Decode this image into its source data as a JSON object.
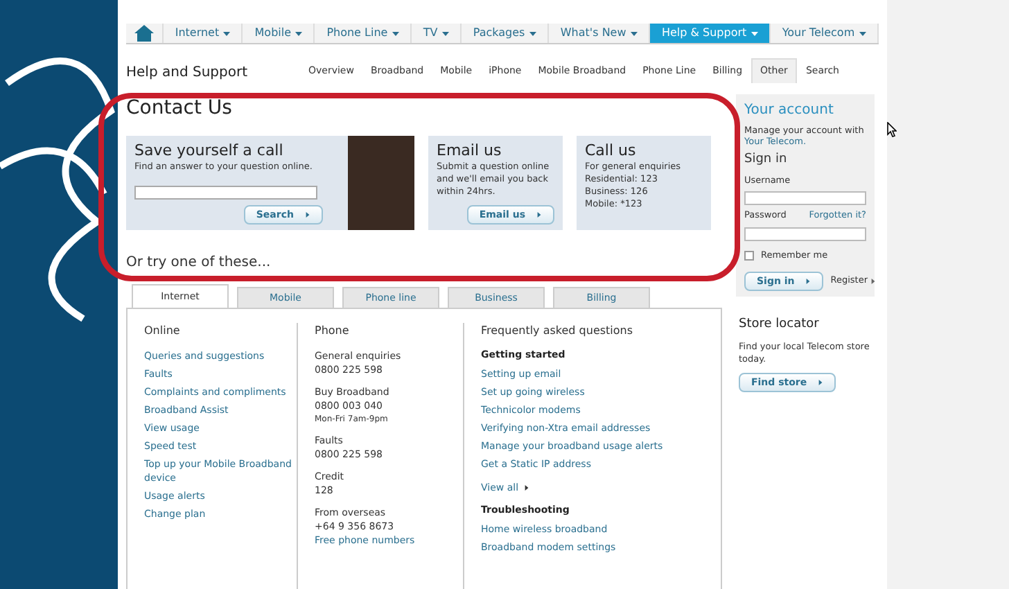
{
  "nav": [
    {
      "kind": "home"
    },
    {
      "kind": "menu",
      "label": "Internet",
      "selected": false
    },
    {
      "kind": "menu",
      "label": "Mobile",
      "selected": false
    },
    {
      "kind": "menu",
      "label": "Phone Line",
      "selected": false
    },
    {
      "kind": "menu",
      "label": "TV",
      "selected": false
    },
    {
      "kind": "menu",
      "label": "Packages",
      "selected": false
    },
    {
      "kind": "menu",
      "label": "What's New",
      "selected": false
    },
    {
      "kind": "menu",
      "label": "Help & Support",
      "selected": true
    },
    {
      "kind": "menu",
      "label": "Your Telecom",
      "selected": false
    }
  ],
  "page_title": "Help and Support",
  "subnav": [
    {
      "label": "Overview",
      "selected": false
    },
    {
      "label": "Broadband",
      "selected": false
    },
    {
      "label": "Mobile",
      "selected": false
    },
    {
      "label": "iPhone",
      "selected": false
    },
    {
      "label": "Mobile Broadband",
      "selected": false
    },
    {
      "label": "Phone Line",
      "selected": false
    },
    {
      "label": "Billing",
      "selected": false
    },
    {
      "label": "Other",
      "selected": true
    },
    {
      "label": "Search",
      "selected": false
    }
  ],
  "contact": {
    "title": "Contact Us",
    "cards": [
      {
        "kind": "search",
        "title": "Save yourself a call",
        "text": "Find an answer to your question online.",
        "button": "Search"
      },
      {
        "kind": "email",
        "title": "Email us",
        "text": "Submit a question online and we'll email you back within 24hrs.",
        "button": "Email us"
      },
      {
        "kind": "call",
        "title": "Call us",
        "lines": [
          "For general enquiries",
          "Residential: 123",
          "Business: 126",
          "Mobile: *123"
        ]
      }
    ]
  },
  "account": {
    "title": "Your account",
    "text": "Manage your account with",
    "link": "Your Telecom.",
    "signin_title": "Sign in",
    "username_label": "Username",
    "password_label": "Password",
    "forgot": "Forgotten it?",
    "remember": {
      "label": "Remember me",
      "checked": false
    },
    "signin_button": "Sign in",
    "register": "Register"
  },
  "store": {
    "title": "Store locator",
    "text": "Find your local Telecom store today.",
    "button": "Find store"
  },
  "try_heading": "Or try one of these...",
  "tabs": [
    {
      "label": "Internet",
      "selected": true
    },
    {
      "label": "Mobile",
      "selected": false
    },
    {
      "label": "Phone line",
      "selected": false
    },
    {
      "label": "Business",
      "selected": false
    },
    {
      "label": "Billing",
      "selected": false
    }
  ],
  "online": {
    "heading": "Online",
    "links": [
      "Queries and suggestions",
      "Faults",
      "Complaints and compliments",
      "Broadband Assist",
      "View usage",
      "Speed test",
      "Top up your Mobile Broadband device",
      "Usage alerts",
      "Change plan"
    ]
  },
  "phone": {
    "heading": "Phone",
    "entries": [
      {
        "label": "General enquiries",
        "number": "0800 225 598"
      },
      {
        "label": "Buy Broadband",
        "number": "0800 003 040",
        "note": "Mon-Fri 7am-9pm"
      },
      {
        "label": "Faults",
        "number": "0800 225 598"
      },
      {
        "label": "Credit",
        "number": "128"
      },
      {
        "label": "From overseas",
        "number": "+64 9 356 8673"
      }
    ],
    "link": "Free phone numbers"
  },
  "faq": {
    "heading": "Frequently asked questions",
    "sections": [
      {
        "title": "Getting started",
        "links": [
          "Setting up email",
          "Set up going wireless",
          "Technicolor modems",
          "Verifying non-Xtra email addresses",
          "Manage your broadband usage alerts",
          "Get a Static IP address"
        ],
        "more": "View all"
      },
      {
        "title": "Troubleshooting",
        "links": [
          "Home wireless broadband",
          "Broadband modem settings"
        ]
      }
    ]
  }
}
